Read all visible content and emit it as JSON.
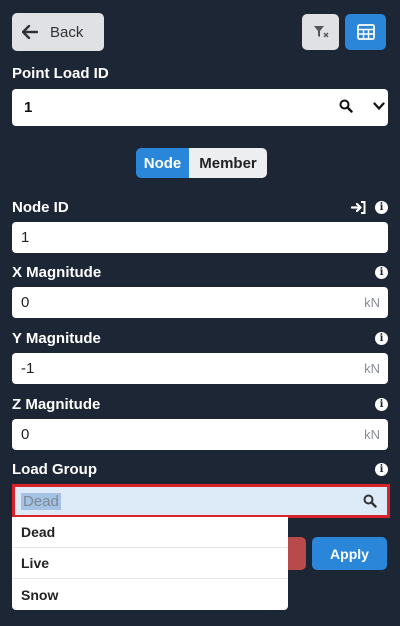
{
  "toolbar": {
    "back_label": "Back"
  },
  "point_load": {
    "label": "Point Load ID",
    "value": "1"
  },
  "toggle": {
    "node_label": "Node",
    "member_label": "Member",
    "selected": "Node"
  },
  "fields": {
    "node_id": {
      "label": "Node ID",
      "value": "1"
    },
    "x_magnitude": {
      "label": "X Magnitude",
      "value": "0",
      "unit": "kN"
    },
    "y_magnitude": {
      "label": "Y Magnitude",
      "value": "-1",
      "unit": "kN"
    },
    "z_magnitude": {
      "label": "Z Magnitude",
      "value": "0",
      "unit": "kN"
    }
  },
  "load_group": {
    "label": "Load Group",
    "value": "Dead",
    "options": [
      "Dead",
      "Live",
      "Snow"
    ]
  },
  "actions": {
    "apply_label": "Apply"
  },
  "colors": {
    "background": "#1c2634",
    "accent": "#2a86d8",
    "danger": "#d9232a"
  }
}
